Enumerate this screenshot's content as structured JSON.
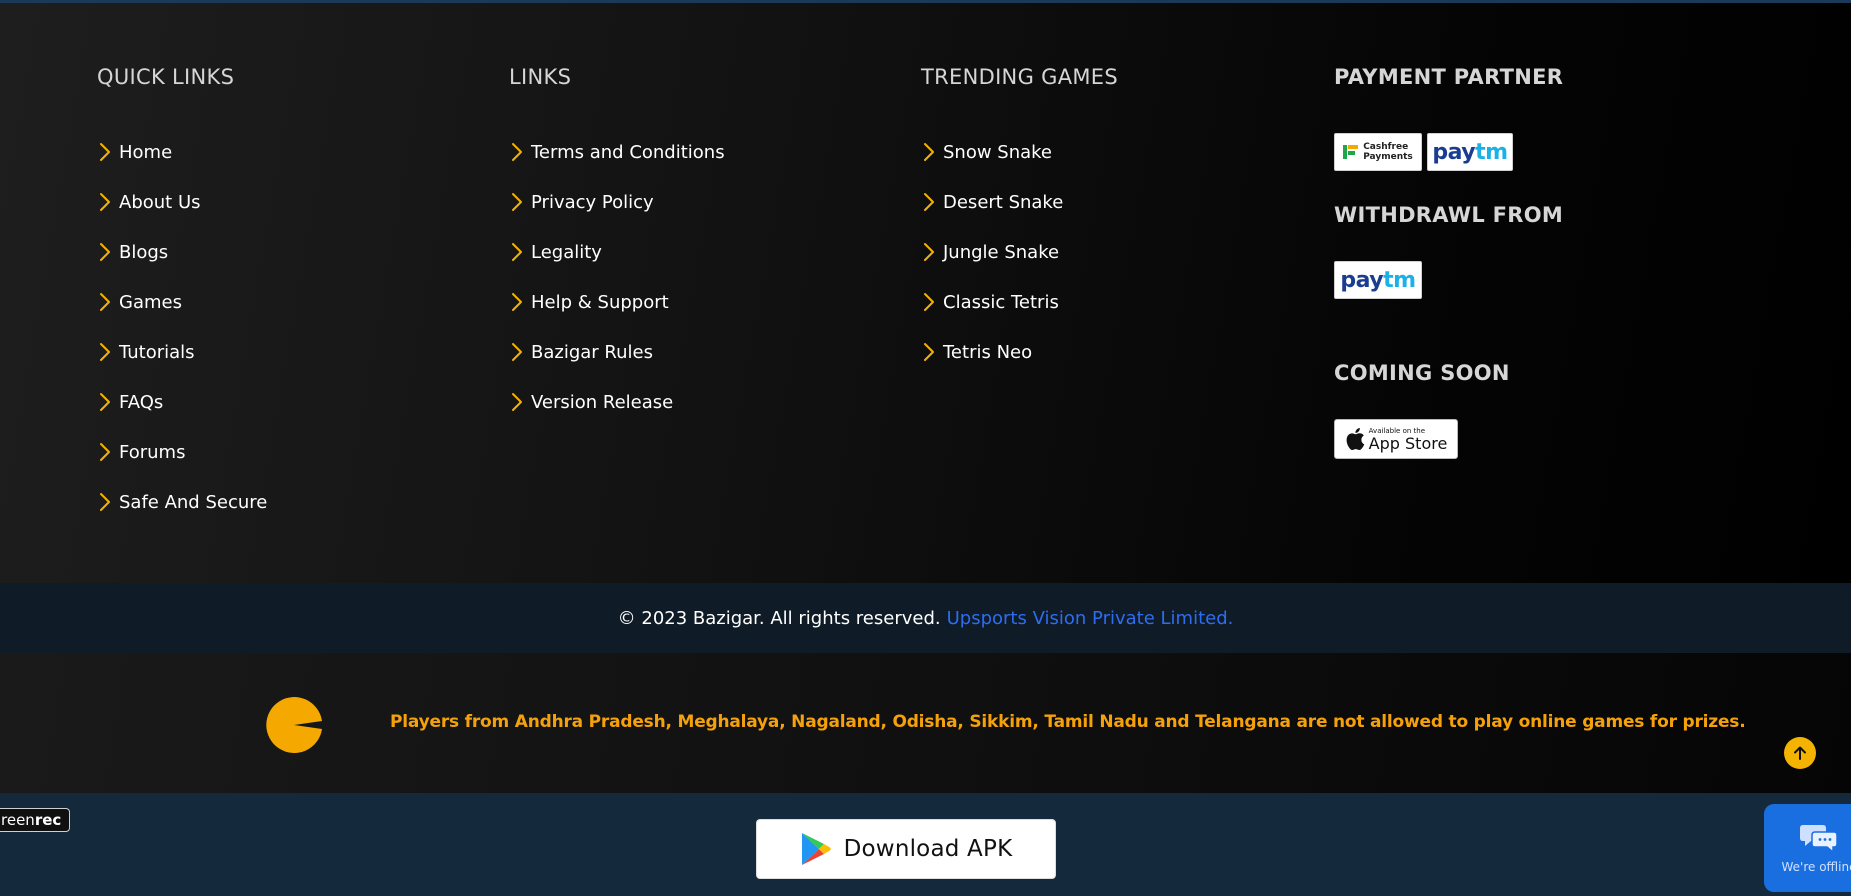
{
  "quick_links": {
    "title": "QUICK LINKS",
    "items": [
      "Home",
      "About Us",
      "Blogs",
      "Games",
      "Tutorials",
      "FAQs",
      "Forums",
      "Safe And Secure"
    ]
  },
  "links": {
    "title": "LINKS",
    "items": [
      "Terms and Conditions",
      "Privacy Policy",
      "Legality",
      "Help & Support",
      "Bazigar Rules",
      "Version Release"
    ]
  },
  "trending_games": {
    "title": "TRENDING GAMES",
    "items": [
      "Snow Snake",
      "Desert Snake",
      "Jungle Snake",
      "Classic Tetris",
      "Tetris Neo"
    ]
  },
  "payment": {
    "title": "PAYMENT PARTNER",
    "cashfree_line1": "Cashfree",
    "cashfree_line2": "Payments",
    "paytm_pay": "pay",
    "paytm_tm": "tm",
    "withdrawl_title": "WITHDRAWL FROM",
    "coming_soon_title": "COMING SOON",
    "appstore_small": "Available on the",
    "appstore_big": "App Store"
  },
  "copyright": {
    "text": "© 2023 Bazigar. All rights reserved.",
    "company": "Upsports Vision Private Limited."
  },
  "notice": {
    "text": "Players from Andhra Pradesh, Meghalaya, Nagaland, Odisha, Sikkim, Tamil Nadu and Telangana are not allowed to play online games for prizes."
  },
  "bottom": {
    "screenrec_prefix": "reen",
    "screenrec_suffix": "rec",
    "download_label": "Download APK",
    "chat_status": "We're offline"
  },
  "colors": {
    "accent_yellow": "#f5b301",
    "notice_orange": "#f5a10a",
    "link_blue": "#2d6df0",
    "chat_blue": "#1a6fe0"
  },
  "icons": {
    "chevron": "chevron-right-icon",
    "scroll_top": "arrow-up-icon",
    "play_store": "google-play-icon",
    "apple": "apple-icon",
    "chat": "chat-bubbles-icon"
  }
}
